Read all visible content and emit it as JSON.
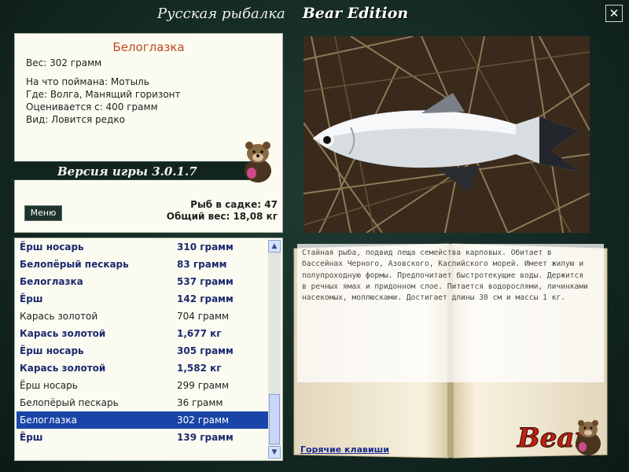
{
  "window": {
    "title": "Русская рыбалка",
    "brand": "Bear Edition",
    "close_glyph": "✕"
  },
  "fish_info": {
    "name": "Белоглазка",
    "weight": "Вес: 302 грамм",
    "bait": "На что поймана: Мотыль",
    "place": "Где: Волга, Манящий горизонт",
    "rated_from": "Оценивается с: 400 грамм",
    "species_status": "Вид: Ловится редко",
    "version": "Версия игры 3.0.1.7",
    "menu_label": "Меню",
    "fish_in_cage": "Рыб в садке: 47",
    "total_weight": "Общий вес: 18,08 кг"
  },
  "catch_list": [
    {
      "name": "Ёрш носарь",
      "weight": "310 грамм",
      "style": "bold"
    },
    {
      "name": "Белопёрый пескарь",
      "weight": "83 грамм",
      "style": "bold"
    },
    {
      "name": "Белоглазка",
      "weight": "537 грамм",
      "style": "bold"
    },
    {
      "name": "Ёрш",
      "weight": "142 грамм",
      "style": "bold"
    },
    {
      "name": "Карась золотой",
      "weight": "704 грамм",
      "style": "regular"
    },
    {
      "name": "Карась золотой",
      "weight": "1,677 кг",
      "style": "bold"
    },
    {
      "name": "Ёрш носарь",
      "weight": "305 грамм",
      "style": "bold"
    },
    {
      "name": "Карась золотой",
      "weight": "1,582 кг",
      "style": "bold"
    },
    {
      "name": "Ёрш носарь",
      "weight": "299 грамм",
      "style": "regular"
    },
    {
      "name": "Белопёрый пескарь",
      "weight": "36 грамм",
      "style": "regular"
    },
    {
      "name": "Белоглазка",
      "weight": "302 грамм",
      "style": "selected"
    },
    {
      "name": "Ёрш",
      "weight": "139 грамм",
      "style": "bold"
    }
  ],
  "description": {
    "text": "Стайная рыба, подвид леща семейства карповых. Обитает в бассейнах Черного, Азовского, Каспийского морей. Имеет жилую и полупроходную формы. Предпочитает быстротекущие воды. Держится в речных ямах и придонном слое. Питается водорослями, личинками насекомых, моллюсками. Достигает длины 30 см и массы 1 кг.",
    "hotkeys_link": "Горячие клавиши",
    "logo_text": "Bear"
  },
  "colors": {
    "background": "#1a322b",
    "panel": "#fbfbf1",
    "fish_name": "#c04a1e",
    "list_bold": "#1c2a6e",
    "selection": "#1a45a8",
    "link": "#1a2a8a",
    "logo_red": "#c02010"
  },
  "icons": {
    "close": "close-icon",
    "scroll_up": "scroll-up-icon",
    "scroll_down": "scroll-down-icon",
    "mascot": "bear-mascot-icon"
  }
}
